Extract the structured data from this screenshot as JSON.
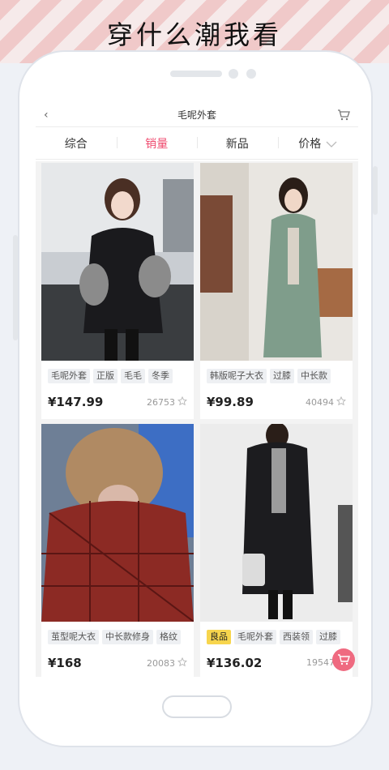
{
  "banner": {
    "title": "穿什么潮我看"
  },
  "header": {
    "back_glyph": "‹",
    "title": "毛呢外套"
  },
  "tabs": [
    {
      "label": "综合",
      "active": false
    },
    {
      "label": "销量",
      "active": true
    },
    {
      "label": "新品",
      "active": false
    },
    {
      "label": "价格",
      "active": false
    }
  ],
  "products": [
    {
      "tags": [
        "毛呢外套",
        "正版",
        "毛毛",
        "冬季"
      ],
      "highlight_tag": "",
      "price": "¥147.99",
      "sales": "26753"
    },
    {
      "tags": [
        "韩版呢子大衣",
        "过膝",
        "中长款"
      ],
      "highlight_tag": "",
      "price": "¥99.89",
      "sales": "40494"
    },
    {
      "tags": [
        "茧型呢大衣",
        "中长款修身",
        "格纹"
      ],
      "highlight_tag": "",
      "price": "¥168",
      "sales": "20083"
    },
    {
      "tags": [
        "毛呢外套",
        "西装领",
        "过膝"
      ],
      "highlight_tag": "良品",
      "price": "¥136.02",
      "sales": "19547"
    }
  ],
  "colors": {
    "accent": "#ef4a6e",
    "fab": "#ef6a80",
    "banner_stripe": "#f0c9c9",
    "highlight_tag": "#f7d54d"
  },
  "icons": [
    "back-icon",
    "cart-icon",
    "chevron-down-icon",
    "star-icon",
    "cart-fab-icon"
  ]
}
